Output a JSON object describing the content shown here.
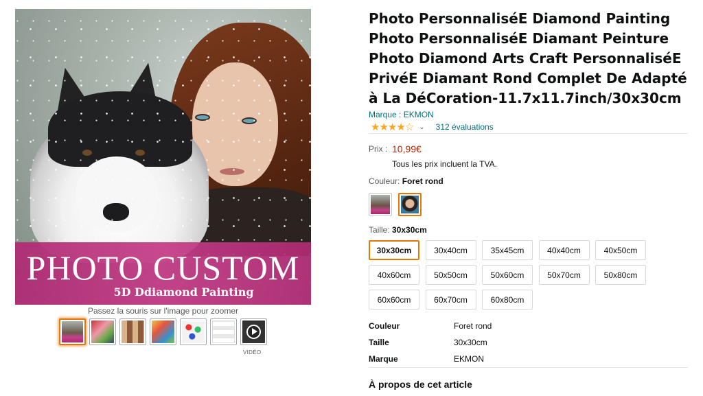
{
  "gallery": {
    "banner_title": "PHOTO CUSTOM",
    "banner_subtitle": "5D Ddiamond Painting",
    "zoom_hint": "Passez la souris sur l'image pour zoomer",
    "video_label": "VIDÉO",
    "thumbnails": [
      "thumb-1",
      "thumb-2",
      "thumb-3",
      "thumb-4",
      "thumb-5",
      "thumb-6",
      "thumb-video"
    ]
  },
  "product": {
    "title": "Photo PersonnaliséE Diamond Painting Photo PersonnaliséE Diamant Peinture Photo Diamond Arts Craft PersonnaliséE PrivéE Diamant Rond Complet De Adapté à La DéCoration-11.7x11.7inch/30x30cm",
    "brand": "Marque : EKMON",
    "stars": "★★★★",
    "star_empty": "☆",
    "chevron": "⌄",
    "reviews": "312 évaluations",
    "rating": 4.2
  },
  "price": {
    "label": "Prix :",
    "value": "10,99€",
    "tva_note": "Tous les prix incluent la TVA."
  },
  "color": {
    "label": "Couleur:",
    "selected": "Foret rond"
  },
  "size": {
    "label": "Taille:",
    "selected": "30x30cm",
    "options": [
      "30x30cm",
      "30x40cm",
      "35x45cm",
      "40x40cm",
      "40x50cm",
      "40x60cm",
      "50x50cm",
      "50x60cm",
      "50x70cm",
      "50x80cm",
      "60x60cm",
      "60x70cm",
      "60x80cm"
    ]
  },
  "specs": [
    {
      "key": "Couleur",
      "value": "Foret rond"
    },
    {
      "key": "Taille",
      "value": "30x30cm"
    },
    {
      "key": "Marque",
      "value": "EKMON"
    }
  ],
  "about": "À propos de cet article",
  "colors": {
    "accent_orange": "#e77600",
    "price_red": "#b12704",
    "link_teal": "#007185",
    "star_gold": "#ffa41c",
    "banner_pink": "#b02a73"
  }
}
